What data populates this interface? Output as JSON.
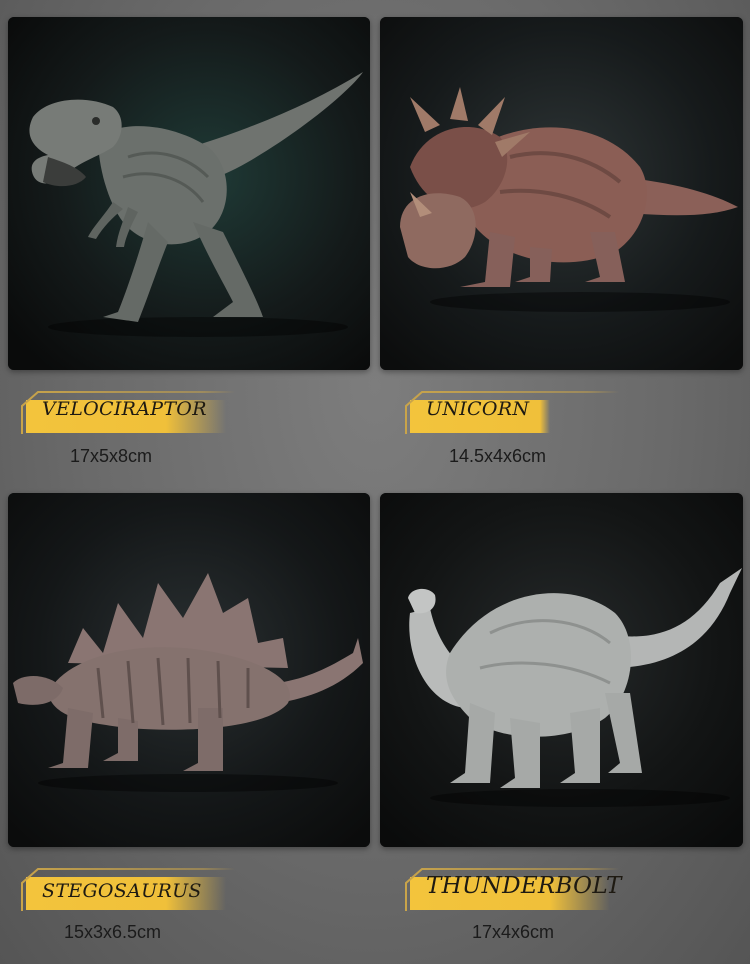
{
  "products": [
    {
      "name": "VELOCIRAPTOR",
      "size": "17x5x8cm",
      "figure_icon": "velociraptor-figure",
      "figure_color": "#6f736f"
    },
    {
      "name": "UNICORN",
      "size": "14.5x4x6cm",
      "figure_icon": "styracosaurus-figure",
      "figure_color": "#8b6058"
    },
    {
      "name": "STEGOSAURUS",
      "size": "15x3x6.5cm",
      "figure_icon": "stegosaurus-figure",
      "figure_color": "#85726e"
    },
    {
      "name": "THUNDERBOLT",
      "size": "17x4x6cm",
      "figure_icon": "brontosaurus-figure",
      "figure_color": "#b4b6b5"
    }
  ],
  "colors": {
    "label_gold": "#f3c43c",
    "label_border": "#c9a44a",
    "photo_background": "#16191b"
  }
}
